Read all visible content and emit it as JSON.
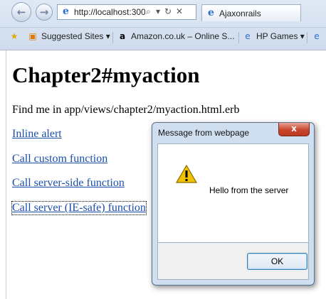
{
  "browser": {
    "address": "http://localhost:300",
    "tab_title": "Ajaxonrails",
    "favorites": [
      {
        "label": "Suggested Sites ▾"
      },
      {
        "label": "Amazon.co.uk – Online S..."
      },
      {
        "label": "HP Games ▾"
      }
    ]
  },
  "page": {
    "title": "Chapter2#myaction",
    "find_text": "Find me in app/views/chapter2/myaction.html.erb",
    "links": [
      "Inline alert",
      "Call custom function",
      "Call server-side function",
      "Call server (IE-safe) function"
    ]
  },
  "dialog": {
    "title": "Message from webpage",
    "message": "Hello from the server",
    "ok_label": "OK",
    "close_glyph": "x"
  },
  "colors": {
    "link": "#1a4fa8",
    "dialog_frame": "#cfdff0",
    "close_button": "#c9452c",
    "warning": "#f2c200"
  }
}
